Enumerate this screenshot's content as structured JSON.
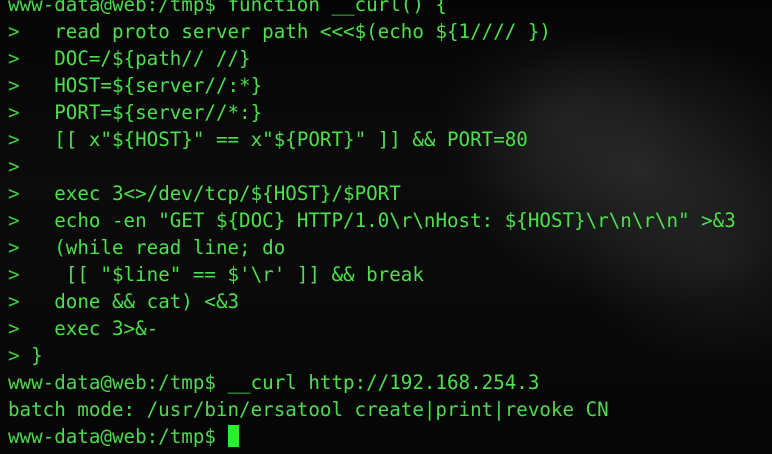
{
  "colors": {
    "background": "#000000",
    "text": "#4fe04f",
    "cursor": "#2af02a"
  },
  "terminal": {
    "prompt": "www-data@web:/tmp$",
    "continuation_prompt": ">",
    "function_header": "function __curl() {",
    "function_body": [
      "  read proto server path <<<$(echo ${1//// })",
      "  DOC=/${path// //}",
      "  HOST=${server//:*}",
      "  PORT=${server//*:}",
      "  [[ x\"${HOST}\" == x\"${PORT}\" ]] && PORT=80",
      "",
      "  exec 3<>/dev/tcp/${HOST}/$PORT",
      "  echo -en \"GET ${DOC} HTTP/1.0\\r\\nHost: ${HOST}\\r\\n\\r\\n\" >&3",
      "  (while read line; do",
      "   [[ \"$line\" == $'\\r' ]] && break",
      "  done && cat) <&3",
      "  exec 3>&-",
      "}"
    ],
    "command": "__curl http://192.168.254.3",
    "output": "batch mode: /usr/bin/ersatool create|print|revoke CN"
  }
}
